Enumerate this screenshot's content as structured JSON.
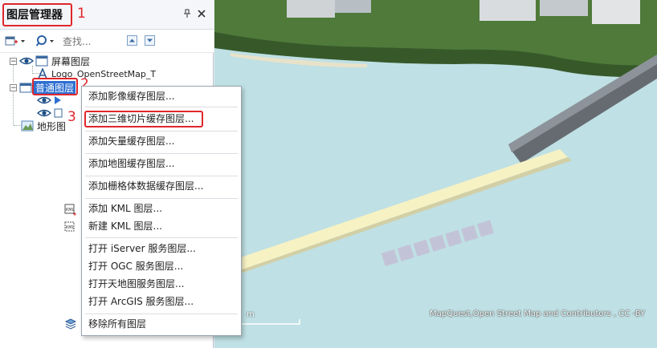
{
  "panel": {
    "title": "图层管理器",
    "pin_icon": "pin-icon",
    "close_icon": "close-icon"
  },
  "annotations": {
    "n1": "1",
    "n2": "2",
    "n3": "3",
    "color": "#e0262b"
  },
  "toolbar": {
    "search_placeholder": "查找..."
  },
  "tree": {
    "screen_layers": "屏幕图层",
    "logo_layer": "Logo_OpenStreetMap_T",
    "normal_layers": "普通图层",
    "terrain_layers": "地形图"
  },
  "menu": {
    "items": [
      "添加影像缓存图层...",
      "添加三维切片缓存图层...",
      "添加矢量缓存图层...",
      "添加地图缓存图层...",
      "添加栅格体数据缓存图层...",
      "添加 KML 图层...",
      "新建 KML 图层...",
      "打开 iServer 服务图层...",
      "打开 OGC 服务图层...",
      "打开天地图服务图层...",
      "打开 ArcGIS 服务图层...",
      "移除所有图层"
    ]
  },
  "map": {
    "attribution": "MapQuest,Open Street Map and Contributors , CC -BY",
    "scale_label": "m",
    "water_color": "#bfe0e4",
    "road_color": "#f6f2c4"
  }
}
